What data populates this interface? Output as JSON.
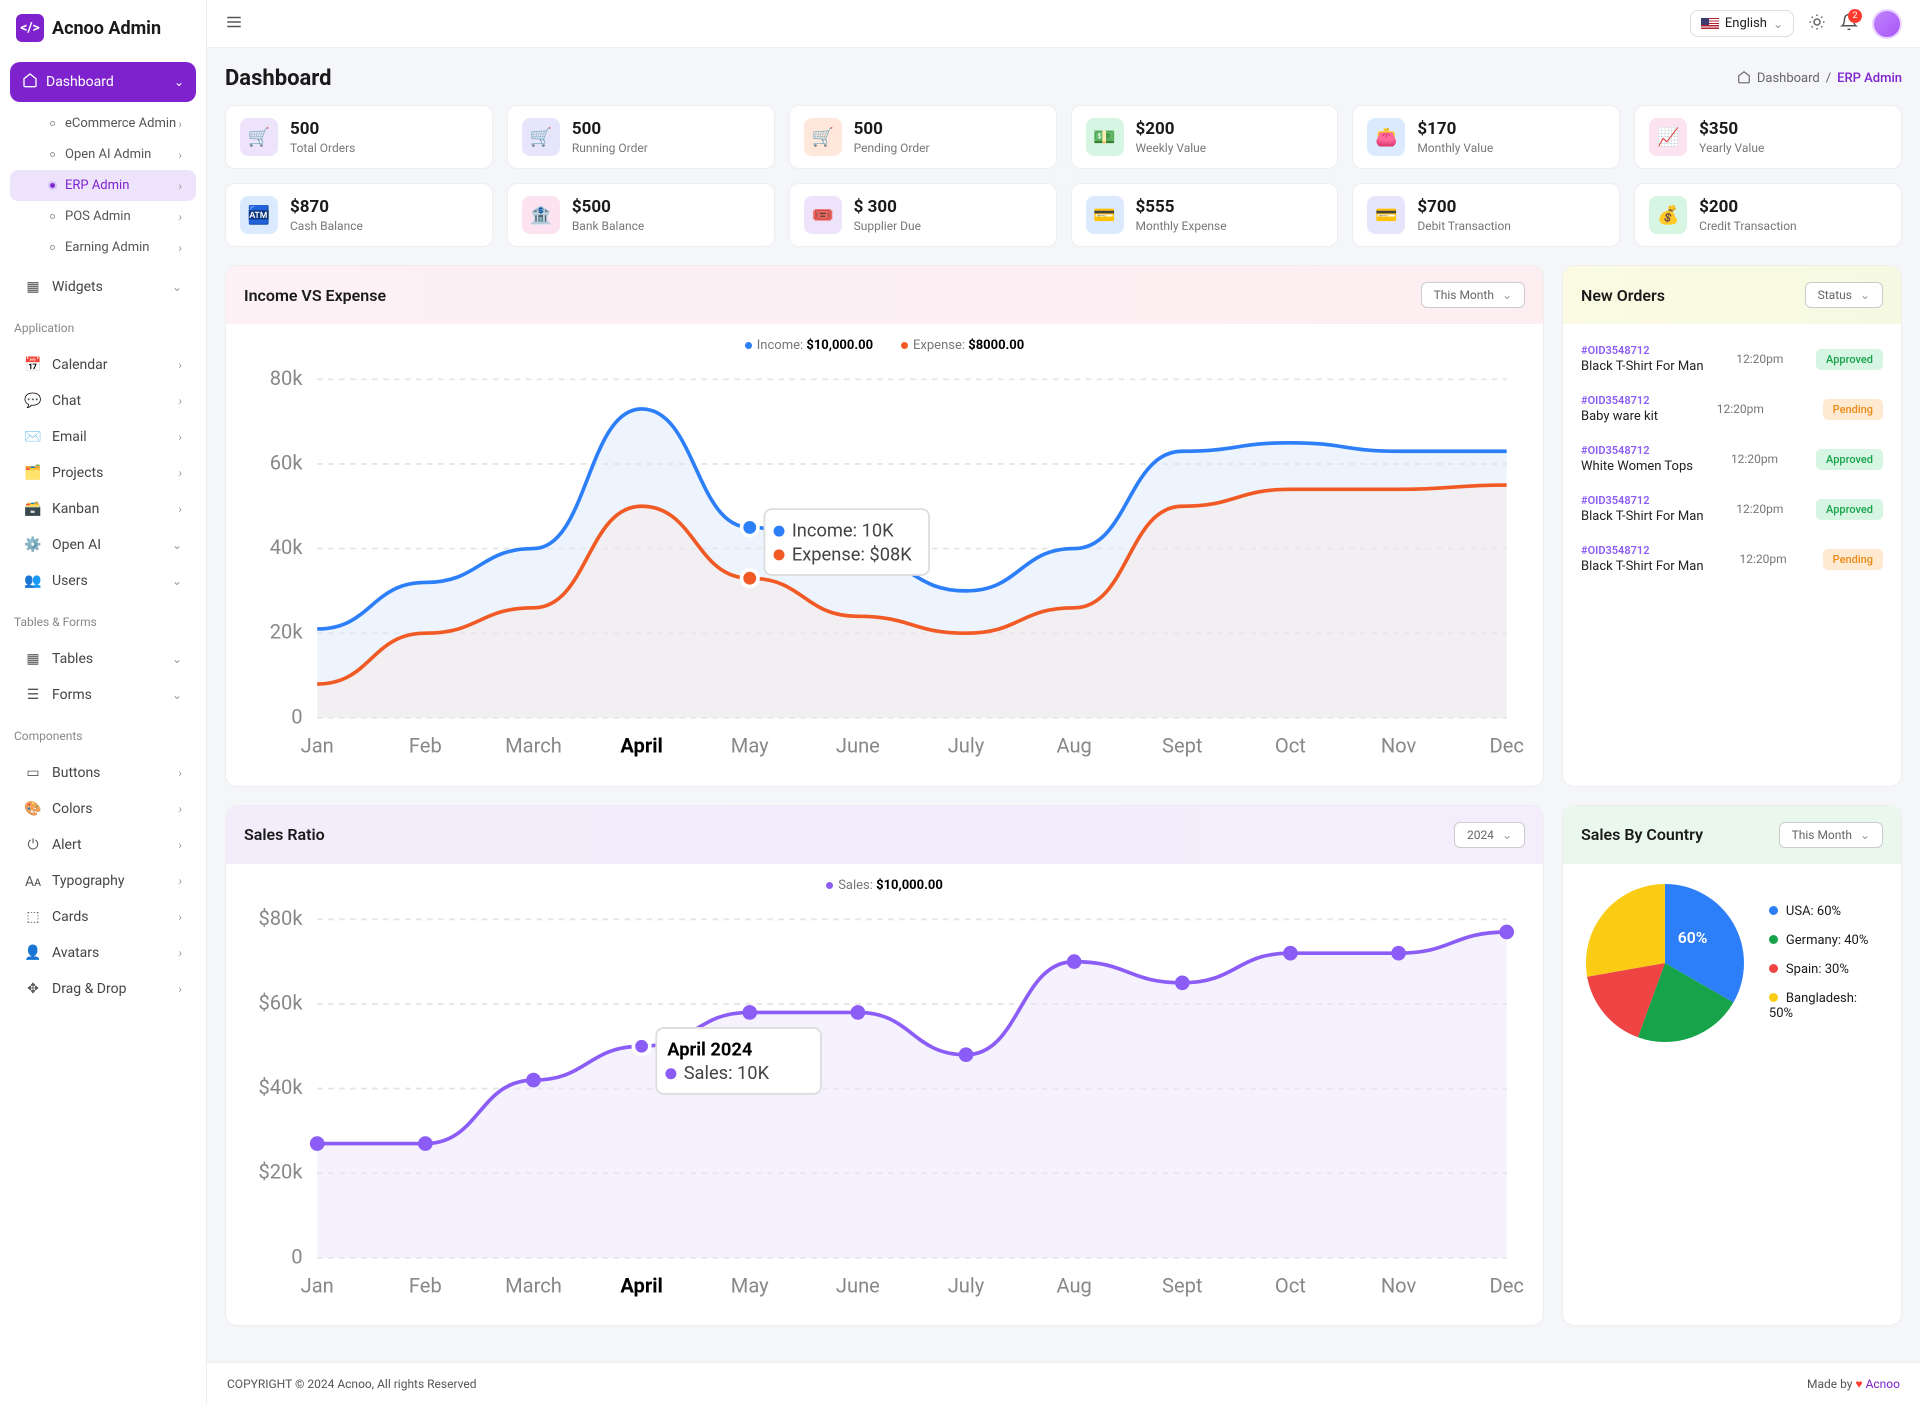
{
  "app": {
    "name": "Acnoo Admin"
  },
  "topbar": {
    "language": "English",
    "notifications_count": "2"
  },
  "page": {
    "title": "Dashboard",
    "breadcrumb_root": "Dashboard",
    "breadcrumb_current": "ERP Admin"
  },
  "sidebar": {
    "dashboard_label": "Dashboard",
    "sub_items": [
      {
        "label": "eCommerce Admin"
      },
      {
        "label": "Open AI Admin"
      },
      {
        "label": "ERP Admin"
      },
      {
        "label": "POS Admin"
      },
      {
        "label": "Earning Admin"
      }
    ],
    "widgets_label": "Widgets",
    "sections": {
      "application": {
        "title": "Application",
        "items": [
          "Calendar",
          "Chat",
          "Email",
          "Projects",
          "Kanban",
          "Open AI",
          "Users"
        ]
      },
      "tables_forms": {
        "title": "Tables & Forms",
        "items": [
          "Tables",
          "Forms"
        ]
      },
      "components": {
        "title": "Components",
        "items": [
          "Buttons",
          "Colors",
          "Alert",
          "Typography",
          "Cards",
          "Avatars",
          "Drag & Drop"
        ]
      }
    }
  },
  "stats": [
    {
      "value": "500",
      "label": "Total Orders",
      "bg": "#ede4fc",
      "fg": "#7e22ce",
      "icon": "🛒"
    },
    {
      "value": "500",
      "label": "Running Order",
      "bg": "#e7e5fb",
      "fg": "#5b5bd6",
      "icon": "🛒"
    },
    {
      "value": "500",
      "label": "Pending Order",
      "bg": "#ffe8db",
      "fg": "#f97316",
      "icon": "🛒"
    },
    {
      "value": "$200",
      "label": "Weekly Value",
      "bg": "#d7f5e3",
      "fg": "#16a34a",
      "icon": "💵"
    },
    {
      "value": "$170",
      "label": "Monthly Value",
      "bg": "#dbeafe",
      "fg": "#2563eb",
      "icon": "👛"
    },
    {
      "value": "$350",
      "label": "Yearly Value",
      "bg": "#fde2f0",
      "fg": "#db2777",
      "icon": "📈"
    },
    {
      "value": "$870",
      "label": "Cash Balance",
      "bg": "#dbeafe",
      "fg": "#2563eb",
      "icon": "🏧"
    },
    {
      "value": "$500",
      "label": "Bank Balance",
      "bg": "#fde2f0",
      "fg": "#db2777",
      "icon": "🏦"
    },
    {
      "value": "$ 300",
      "label": "Supplier Due",
      "bg": "#ede4fc",
      "fg": "#7e22ce",
      "icon": "🎟️"
    },
    {
      "value": "$555",
      "label": "Monthly Expense",
      "bg": "#dbeafe",
      "fg": "#2563eb",
      "icon": "💳"
    },
    {
      "value": "$700",
      "label": "Debit Transaction",
      "bg": "#e7e5fb",
      "fg": "#5b5bd6",
      "icon": "💳"
    },
    {
      "value": "$200",
      "label": "Credit Transaction",
      "bg": "#d7f5e3",
      "fg": "#16a34a",
      "icon": "💰"
    }
  ],
  "income_expense": {
    "title": "Income VS Expense",
    "filter": "This Month",
    "legend": {
      "income_label": "Income:",
      "income_value": "$10,000.00",
      "expense_label": "Expense:",
      "expense_value": "$8000.00"
    },
    "tooltip": {
      "income": "Income: 10K",
      "expense": "Expense: $08K"
    }
  },
  "orders_panel": {
    "title": "New Orders",
    "filter": "Status",
    "items": [
      {
        "oid": "#OID3548712",
        "name": "Black T-Shirt For Man",
        "time": "12:20pm",
        "status": "Approved"
      },
      {
        "oid": "#OID3548712",
        "name": "Baby ware kit",
        "time": "12:20pm",
        "status": "Pending"
      },
      {
        "oid": "#OID3548712",
        "name": "White Women Tops",
        "time": "12:20pm",
        "status": "Approved"
      },
      {
        "oid": "#OID3548712",
        "name": "Black T-Shirt For Man",
        "time": "12:20pm",
        "status": "Approved"
      },
      {
        "oid": "#OID3548712",
        "name": "Black T-Shirt For Man",
        "time": "12:20pm",
        "status": "Pending"
      }
    ]
  },
  "sales_ratio": {
    "title": "Sales Ratio",
    "filter": "2024",
    "legend": {
      "label": "Sales:",
      "value": "$10,000.00"
    },
    "tooltip": {
      "title": "April 2024",
      "sales": "Sales: 10K"
    }
  },
  "sales_country": {
    "title": "Sales By Country",
    "filter": "This Month",
    "items": [
      {
        "label": "USA: 60%",
        "color": "#2d7ff9"
      },
      {
        "label": "Germany: 40%",
        "color": "#16a34a"
      },
      {
        "label": "Spain: 30%",
        "color": "#ef4444"
      },
      {
        "label": "Bangladesh: 50%",
        "color": "#facc15"
      }
    ],
    "center_label": "60%"
  },
  "chart_data": [
    {
      "id": "income_expense",
      "type": "area",
      "x": [
        "Jan",
        "Feb",
        "March",
        "April",
        "May",
        "June",
        "July",
        "Aug",
        "Sept",
        "Oct",
        "Nov",
        "Dec"
      ],
      "y_ticks": [
        0,
        "20k",
        "40k",
        "60k",
        "80k"
      ],
      "ylim": [
        0,
        80
      ],
      "series": [
        {
          "name": "Income",
          "color": "#2d7ff9",
          "values": [
            21,
            32,
            40,
            73,
            45,
            38,
            30,
            40,
            63,
            65,
            63,
            63
          ]
        },
        {
          "name": "Expense",
          "color": "#f15a24",
          "values": [
            8,
            20,
            26,
            50,
            33,
            24,
            20,
            26,
            50,
            54,
            54,
            55
          ]
        }
      ],
      "tooltip_at": "May"
    },
    {
      "id": "sales_ratio",
      "type": "line",
      "x": [
        "Jan",
        "Feb",
        "March",
        "April",
        "May",
        "June",
        "July",
        "Aug",
        "Sept",
        "Oct",
        "Nov",
        "Dec"
      ],
      "y_ticks": [
        0,
        "$20k",
        "$40k",
        "$60k",
        "$80k"
      ],
      "ylim": [
        0,
        80
      ],
      "series": [
        {
          "name": "Sales",
          "color": "#8b5cf6",
          "values": [
            27,
            27,
            42,
            50,
            58,
            58,
            48,
            70,
            65,
            72,
            72,
            77
          ]
        }
      ],
      "tooltip_at": "April"
    },
    {
      "id": "sales_country",
      "type": "pie",
      "series": [
        {
          "name": "USA",
          "value": 60,
          "color": "#2d7ff9"
        },
        {
          "name": "Germany",
          "value": 40,
          "color": "#16a34a"
        },
        {
          "name": "Spain",
          "value": 30,
          "color": "#ef4444"
        },
        {
          "name": "Bangladesh",
          "value": 50,
          "color": "#facc15"
        }
      ]
    }
  ],
  "footer": {
    "left": "COPYRIGHT © 2024 Acnoo, All rights Reserved",
    "right_prefix": "Made by ",
    "right_brand": "Acnoo"
  }
}
